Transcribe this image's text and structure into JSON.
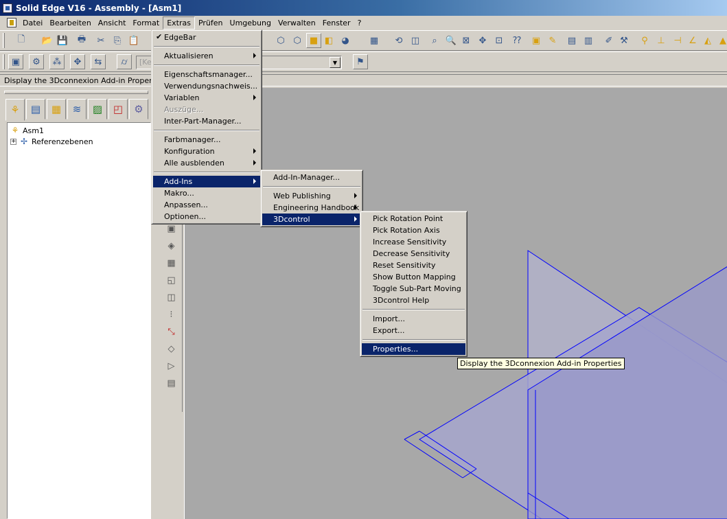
{
  "window": {
    "title": "Solid Edge V16 - Assembly - [Asm1]"
  },
  "menubar": [
    "Datei",
    "Bearbeiten",
    "Ansicht",
    "Format",
    "Extras",
    "Prüfen",
    "Umgebung",
    "Verwalten",
    "Fenster",
    "?"
  ],
  "toolbar2": {
    "combo_placeholder": "[Ke"
  },
  "hint": "Display the 3Dconnexion Add-in Properties",
  "tree": {
    "root": "Asm1",
    "child": "Referenzebenen",
    "expander": "+"
  },
  "extras_menu": {
    "edgebar": "EdgeBar",
    "aktualisieren": "Aktualisieren",
    "eigenschaftsmanager": "Eigenschaftsmanager...",
    "verwendungsnachweis": "Verwendungsnachweis...",
    "variablen": "Variablen",
    "auszuege": "Auszüge...",
    "interpart": "Inter-Part-Manager...",
    "farbmanager": "Farbmanager...",
    "konfiguration": "Konfiguration",
    "alle_ausblenden": "Alle ausblenden",
    "addins": "Add-Ins",
    "makro": "Makro...",
    "anpassen": "Anpassen...",
    "optionen": "Optionen..."
  },
  "addins_menu": {
    "manager": "Add-In-Manager...",
    "web_publishing": "Web Publishing",
    "engineering_handbook": "Engineering Handbook",
    "threed_control": "3Dcontrol"
  },
  "threed_menu": {
    "pick_point": "Pick Rotation Point",
    "pick_axis": "Pick Rotation Axis",
    "increase": "Increase Sensitivity",
    "decrease": "Decrease Sensitivity",
    "reset": "Reset Sensitivity",
    "mapping": "Show Button Mapping",
    "toggle": "Toggle Sub-Part Moving",
    "help": "3Dcontrol Help",
    "import": "Import...",
    "export": "Export...",
    "properties": "Properties..."
  },
  "tooltip": "Display the 3Dconnexion Add-in Properties",
  "colors": {
    "highlight": "#0a246a",
    "face": "#d4d0c8",
    "plane": "#0000ff"
  }
}
